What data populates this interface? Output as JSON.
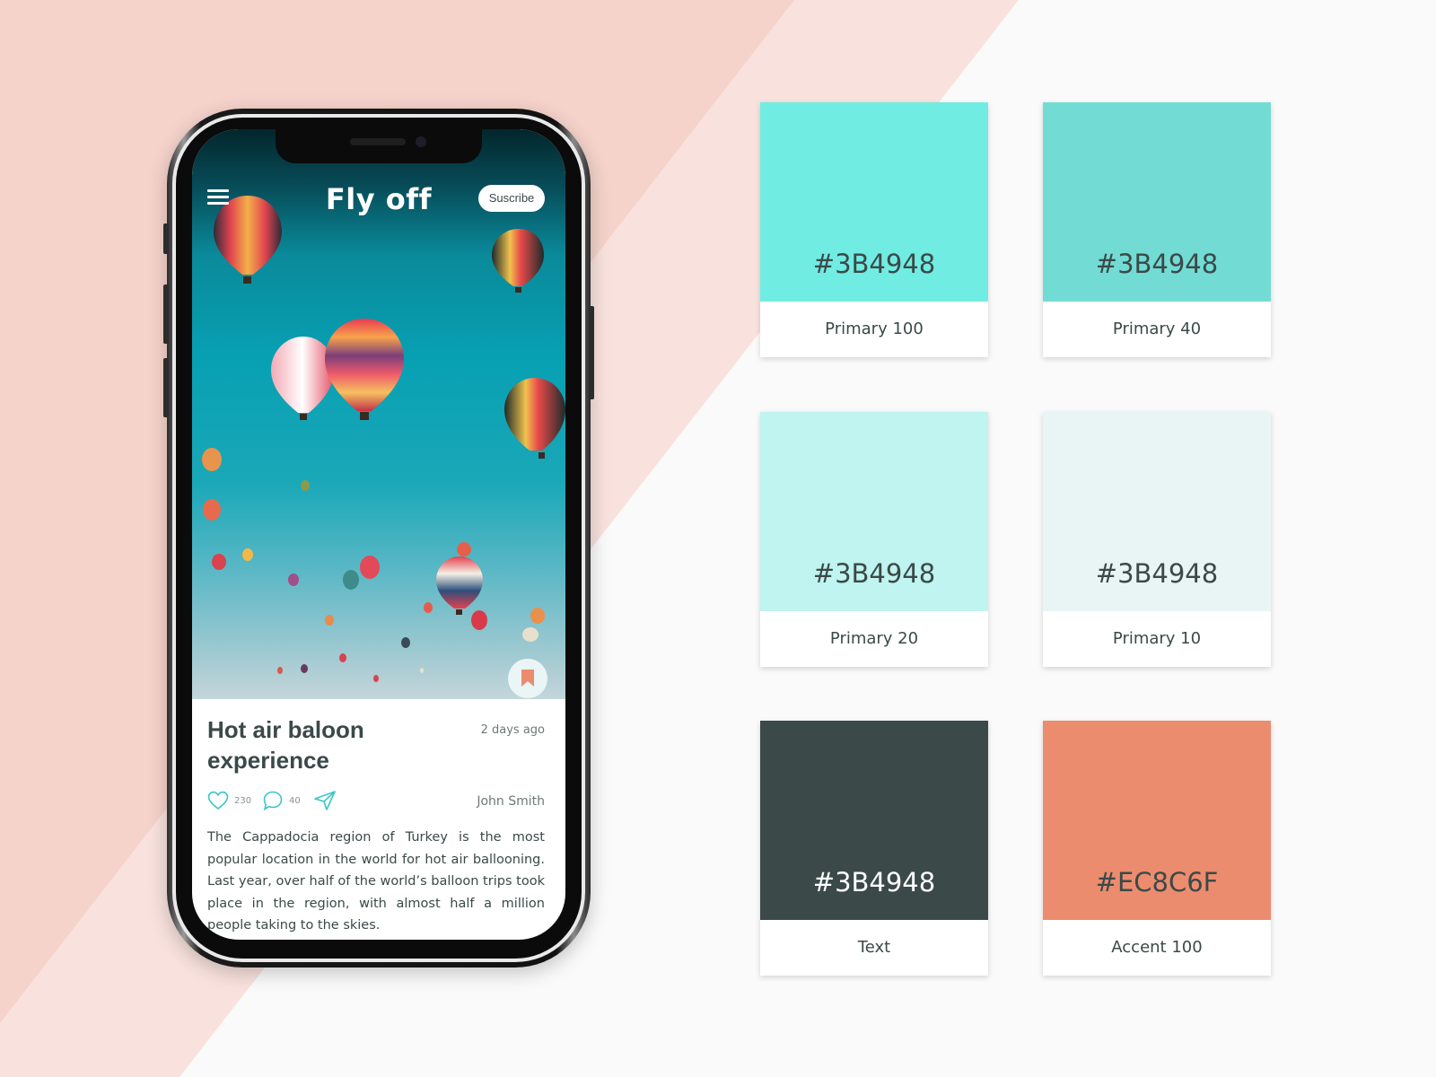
{
  "colors": {
    "background": "#FAFAFA",
    "stripe_dark": "#F5D3CB",
    "stripe_light": "#F9E2DD",
    "text": "#3B4948",
    "accent": "#EC8C6F",
    "teal": "#3AC6C8"
  },
  "phone": {
    "header": {
      "menu_icon": "hamburger-menu-icon",
      "title": "Fly off",
      "subscribe_label": "Suscribe"
    },
    "hero_image": "hot-air-balloons-over-teal-sky",
    "bookmark_icon": "bookmark-icon",
    "post": {
      "title": "Hot air baloon experience",
      "time": "2 days ago",
      "author": "John Smith",
      "likes": {
        "icon": "heart-icon",
        "count": "230"
      },
      "comments": {
        "icon": "comment-bubble-icon",
        "count": "40"
      },
      "share": {
        "icon": "send-paper-plane-icon"
      },
      "body": "The Cappadocia region of Turkey is the most popular location in the world for hot air ballooning. Last year, over half of the world’s balloon trips took place in the region, with almost half a million people taking to the skies."
    }
  },
  "palette": [
    {
      "hex": "#3B4948",
      "name": "Primary 100",
      "swatch": "#71ECE2",
      "hex_color": "#3B4948"
    },
    {
      "hex": "#3B4948",
      "name": "Primary 40",
      "swatch": "#72DCD4",
      "hex_color": "#3B4948"
    },
    {
      "hex": "#3B4948",
      "name": "Primary 20",
      "swatch": "#BFF4F0",
      "hex_color": "#3B4948"
    },
    {
      "hex": "#3B4948",
      "name": "Primary 10",
      "swatch": "#E9F5F4",
      "hex_color": "#3B4948"
    },
    {
      "hex": "#3B4948",
      "name": "Text",
      "swatch": "#3B4948",
      "hex_color": "#FFFFFF"
    },
    {
      "hex": "#EC8C6F",
      "name": "Accent 100",
      "swatch": "#EC8C6F",
      "hex_color": "#3B4948"
    }
  ]
}
